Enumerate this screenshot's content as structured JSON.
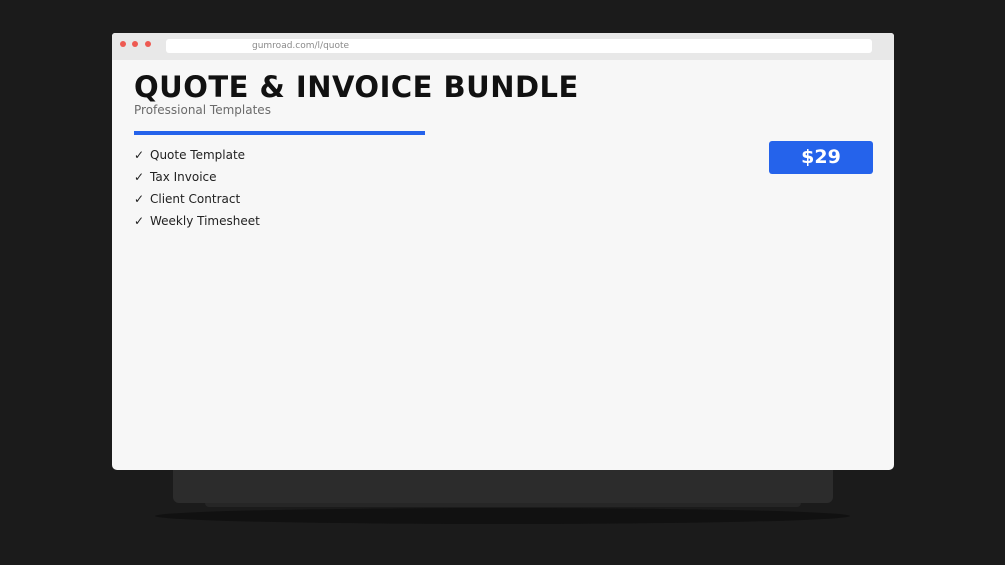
{
  "browser": {
    "url": "gumroad.com/l/quote"
  },
  "product": {
    "title": "QUOTE & INVOICE BUNDLE",
    "subtitle": "Professional Templates",
    "features": [
      {
        "check": "✓",
        "label": "Quote Template"
      },
      {
        "check": "✓",
        "label": "Tax Invoice"
      },
      {
        "check": "✓",
        "label": "Client Contract"
      },
      {
        "check": "✓",
        "label": "Weekly Timesheet"
      }
    ],
    "price": "$29"
  },
  "colors": {
    "accent": "#2563eb",
    "window_dot": "#ee5a52",
    "background": "#1b1b1b",
    "page": "#f7f7f7"
  }
}
